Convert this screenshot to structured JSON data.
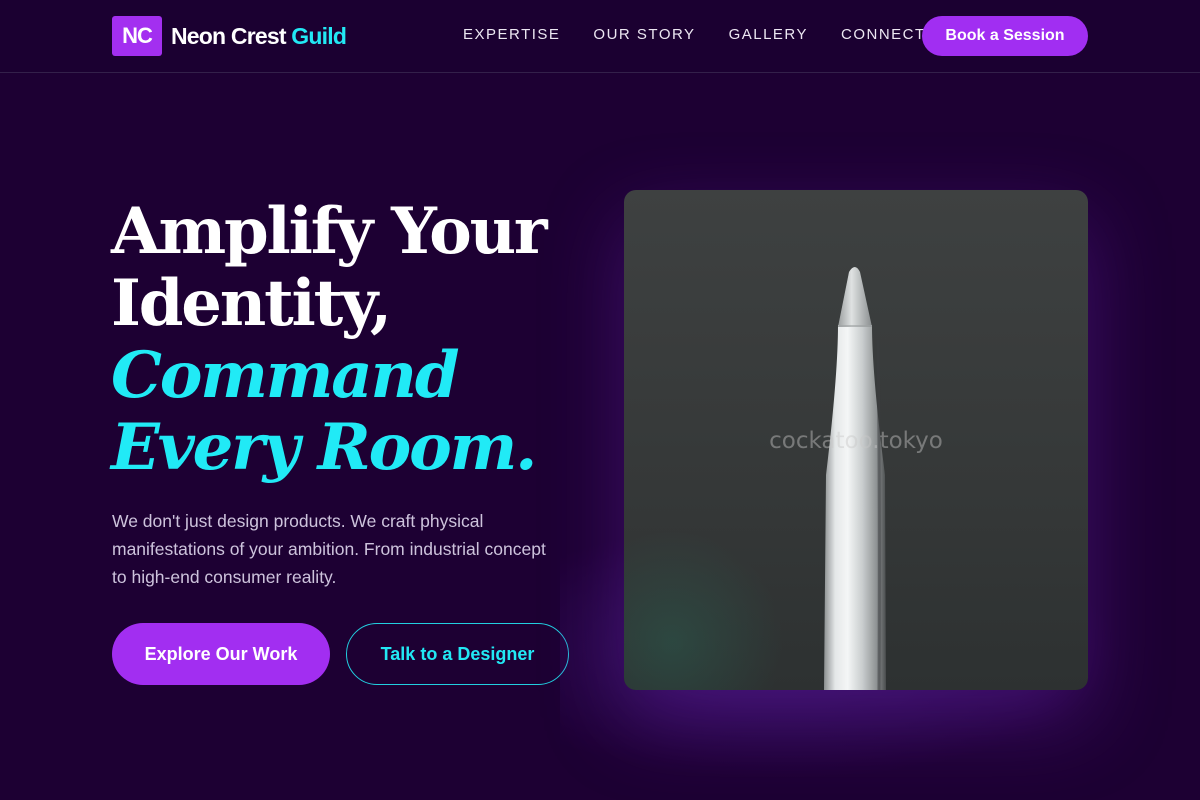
{
  "header": {
    "logo_mark": "NC",
    "brand_name": "Neon Crest",
    "brand_accent": "Guild",
    "nav": [
      "EXPERTISE",
      "OUR STORY",
      "GALLERY",
      "CONNECT"
    ],
    "cta_label": "Book a Session"
  },
  "hero": {
    "headline_lines": [
      "Amplify Your",
      "Identity,"
    ],
    "headline_accent_lines": [
      "Command",
      "Every Room."
    ],
    "subtext": "We don't just design products. We craft physical manifestations of your ambition. From industrial concept to high-end consumer reality.",
    "primary_button": "Explore Our Work",
    "secondary_button": "Talk to a Designer",
    "image_watermark": "cockatoo.tokyo"
  },
  "colors": {
    "background": "#1d0033",
    "primary": "#a22ef1",
    "accent": "#22e8f4"
  },
  "icons": {
    "product_image": "stylus-pencil-photo"
  }
}
